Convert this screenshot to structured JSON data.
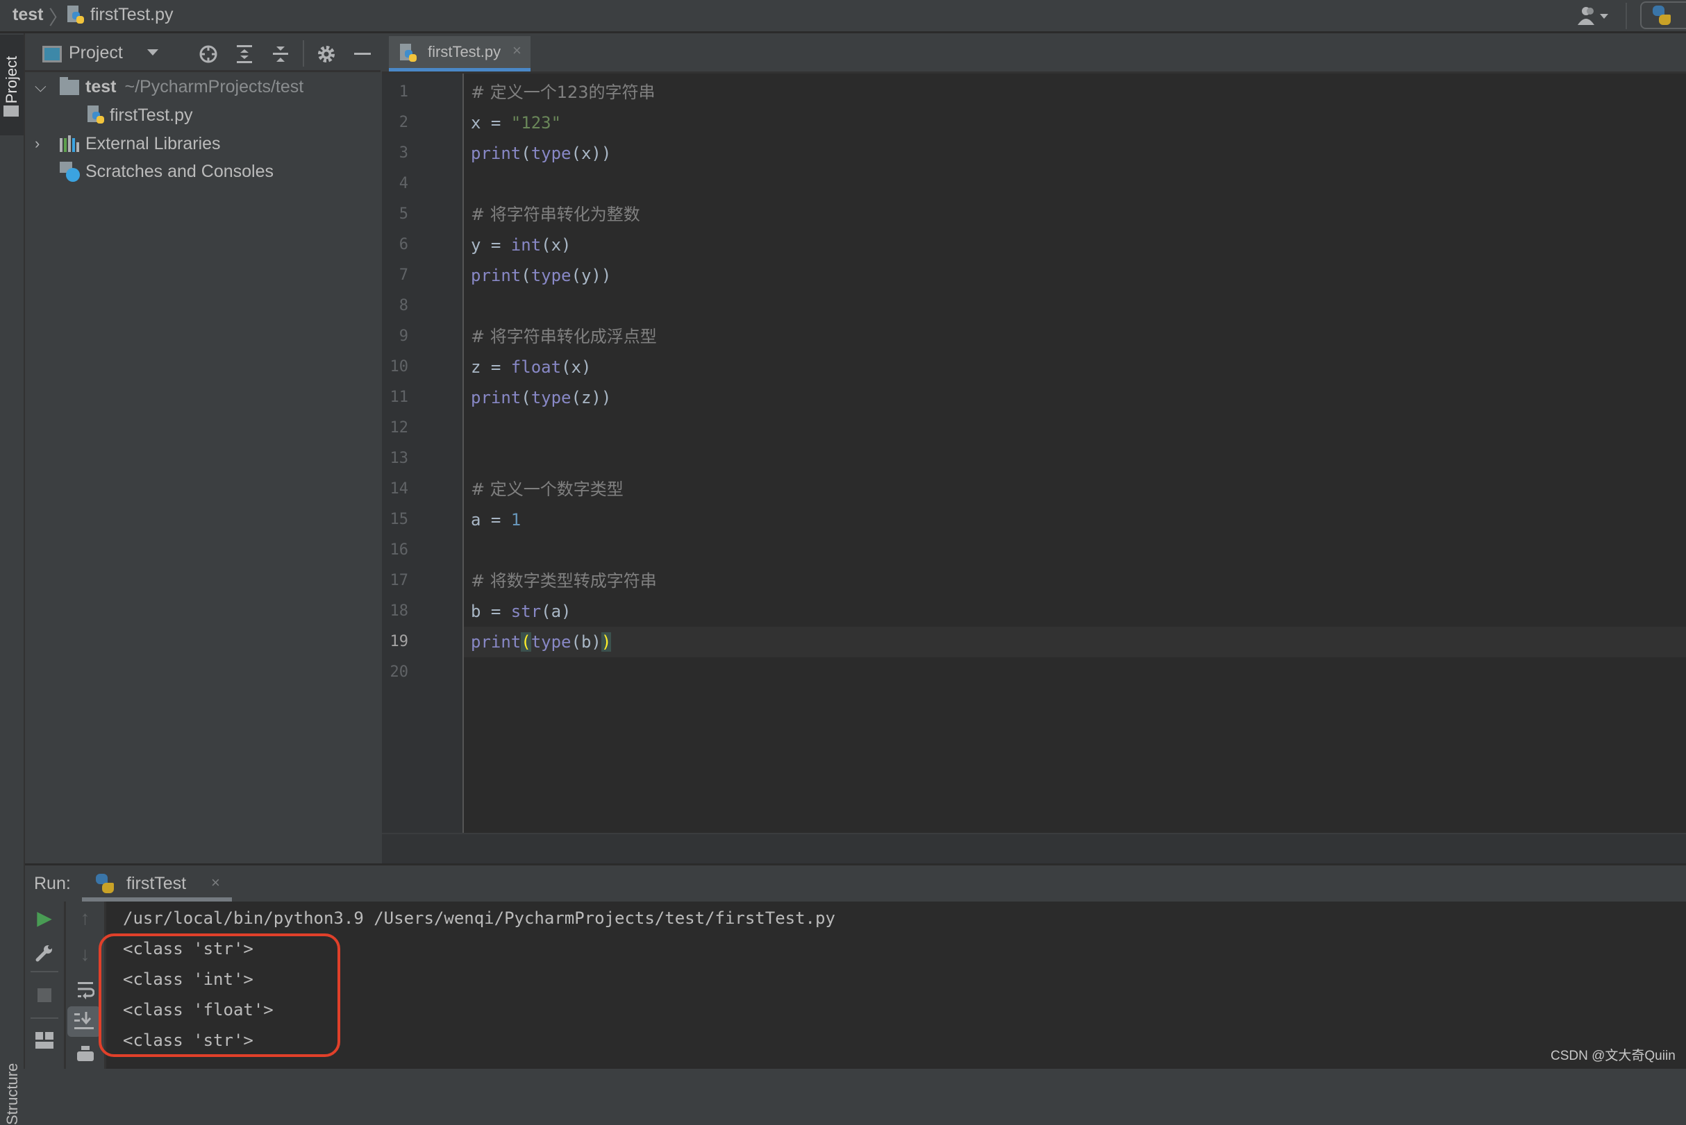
{
  "titlebar": {
    "breadcrumb_root": "test",
    "breadcrumb_separator": "〉",
    "breadcrumb_file": "firstTest.py",
    "file_icon": "python-file-icon",
    "user_icon": "user-account-icon",
    "run_config_icon": "python-run-config-icon"
  },
  "left_strip": {
    "project_tab": "Project",
    "structure_tab": "Structure"
  },
  "project_panel": {
    "view_label": "Project",
    "toolbar_icons": [
      "locate-crosshair-icon",
      "expand-all-icon",
      "collapse-all-icon",
      "gear-icon",
      "minimize-icon"
    ],
    "tree": [
      {
        "label": "test",
        "sublabel": "~/PycharmProjects/test",
        "icon": "folder-icon",
        "expanded": true
      },
      {
        "label": "firstTest.py",
        "icon": "python-file-icon"
      },
      {
        "label": "External Libraries",
        "icon": "libraries-icon",
        "expanded": false
      },
      {
        "label": "Scratches and Consoles",
        "icon": "scratches-icon"
      }
    ]
  },
  "editor": {
    "tab_label": "firstTest.py",
    "tab_close": "×",
    "current_line": 19,
    "line_count": 20,
    "lines": [
      {
        "n": "1",
        "code": "# 定义一个123的字符串"
      },
      {
        "n": "2",
        "code": "x = \"123\""
      },
      {
        "n": "3",
        "code": "print(type(x))"
      },
      {
        "n": "4",
        "code": ""
      },
      {
        "n": "5",
        "code": "# 将字符串转化为整数"
      },
      {
        "n": "6",
        "code": "y = int(x)"
      },
      {
        "n": "7",
        "code": "print(type(y))"
      },
      {
        "n": "8",
        "code": ""
      },
      {
        "n": "9",
        "code": "# 将字符串转化成浮点型"
      },
      {
        "n": "10",
        "code": "z = float(x)"
      },
      {
        "n": "11",
        "code": "print(type(z))"
      },
      {
        "n": "12",
        "code": ""
      },
      {
        "n": "13",
        "code": ""
      },
      {
        "n": "14",
        "code": "# 定义一个数字类型"
      },
      {
        "n": "15",
        "code": "a = 1"
      },
      {
        "n": "16",
        "code": ""
      },
      {
        "n": "17",
        "code": "# 将数字类型转成字符串"
      },
      {
        "n": "18",
        "code": "b = str(a)"
      },
      {
        "n": "19",
        "code": "print(type(b))"
      },
      {
        "n": "20",
        "code": ""
      }
    ]
  },
  "run_panel": {
    "label": "Run:",
    "tab_label": "firstTest",
    "tab_close": "×",
    "tools": [
      "rerun-play-icon",
      "wrench-settings-icon",
      "stop-icon",
      "layout-icon",
      "scroll-up-icon",
      "scroll-down-icon",
      "soft-wrap-icon",
      "scroll-to-end-icon",
      "print-icon"
    ],
    "console": {
      "command": "/usr/local/bin/python3.9 /Users/wenqi/PycharmProjects/test/firstTest.py",
      "output": [
        "<class 'str'>",
        "<class 'int'>",
        "<class 'float'>",
        "<class 'str'>"
      ]
    },
    "highlight_color": "#e0402a"
  },
  "watermark": "CSDN @文大奇Quiin",
  "colors": {
    "editor_bg": "#2b2b2b",
    "panel_bg": "#3c3f41",
    "accent": "#4a88c7",
    "keyword_builtin": "#8888c6",
    "string": "#6a8759",
    "number": "#6897bb",
    "comment": "#808080"
  }
}
